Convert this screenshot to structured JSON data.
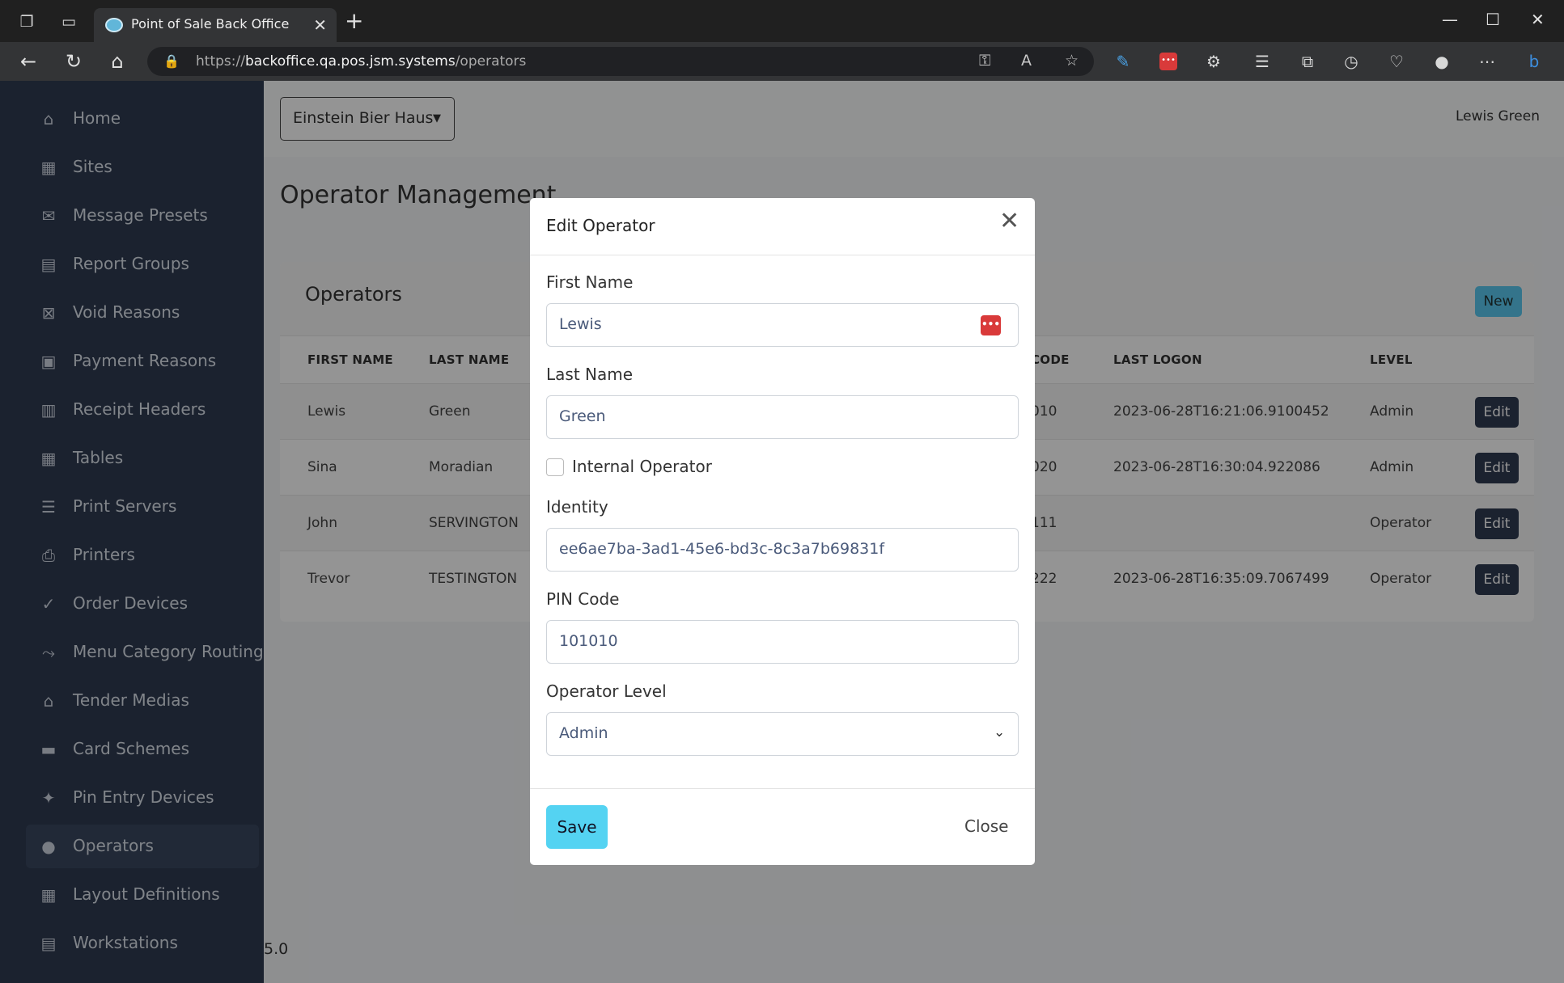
{
  "browser": {
    "tab_title": "Point of Sale Back Office",
    "url_scheme": "https://",
    "url_host": "backoffice.qa.pos.jsm.systems",
    "url_path": "/operators"
  },
  "sidebar": {
    "items": [
      {
        "label": "Home",
        "icon": "home-icon"
      },
      {
        "label": "Sites",
        "icon": "building-icon"
      },
      {
        "label": "Message Presets",
        "icon": "envelope-icon"
      },
      {
        "label": "Report Groups",
        "icon": "chart-icon"
      },
      {
        "label": "Void Reasons",
        "icon": "x-box-icon"
      },
      {
        "label": "Payment Reasons",
        "icon": "money-icon"
      },
      {
        "label": "Receipt Headers",
        "icon": "receipt-icon"
      },
      {
        "label": "Tables",
        "icon": "table-icon"
      },
      {
        "label": "Print Servers",
        "icon": "server-icon"
      },
      {
        "label": "Printers",
        "icon": "printer-icon"
      },
      {
        "label": "Order Devices",
        "icon": "check-icon"
      },
      {
        "label": "Menu Category Routing",
        "icon": "route-icon"
      },
      {
        "label": "Tender Medias",
        "icon": "bank-icon"
      },
      {
        "label": "Card Schemes",
        "icon": "credit-card-icon"
      },
      {
        "label": "Pin Entry Devices",
        "icon": "keypad-icon"
      },
      {
        "label": "Operators",
        "icon": "user-icon"
      },
      {
        "label": "Layout Definitions",
        "icon": "grid-icon"
      },
      {
        "label": "Workstations",
        "icon": "workstation-icon"
      }
    ],
    "active": "Operators"
  },
  "header": {
    "site": "Einstein Bier Haus",
    "user": "Lewis Green"
  },
  "main": {
    "page_title": "Operator Management",
    "card_title": "Operators",
    "new_label": "New",
    "version": "5.0",
    "table": {
      "columns": [
        "FIRST NAME",
        "LAST NAME",
        "CODE",
        "LAST LOGON",
        "LEVEL"
      ],
      "rows": [
        {
          "first": "Lewis",
          "last": "Green",
          "code": "010",
          "logon": "2023-06-28T16:21:06.9100452",
          "level": "Admin"
        },
        {
          "first": "Sina",
          "last": "Moradian",
          "code": "020",
          "logon": "2023-06-28T16:30:04.922086",
          "level": "Admin"
        },
        {
          "first": "John",
          "last": "SERVINGTON",
          "code": "111",
          "logon": "",
          "level": "Operator"
        },
        {
          "first": "Trevor",
          "last": "TESTINGTON",
          "code": "222",
          "logon": "2023-06-28T16:35:09.7067499",
          "level": "Operator"
        }
      ],
      "edit_label": "Edit"
    }
  },
  "modal": {
    "title": "Edit Operator",
    "first_name_label": "First Name",
    "first_name_value": "Lewis",
    "last_name_label": "Last Name",
    "last_name_value": "Green",
    "internal_label": "Internal Operator",
    "internal_checked": false,
    "identity_label": "Identity",
    "identity_value": "ee6ae7ba-3ad1-45e6-bd3c-8c3a7b69831f",
    "pin_label": "PIN Code",
    "pin_value": "101010",
    "level_label": "Operator Level",
    "level_value": "Admin",
    "save_label": "Save",
    "close_label": "Close"
  }
}
